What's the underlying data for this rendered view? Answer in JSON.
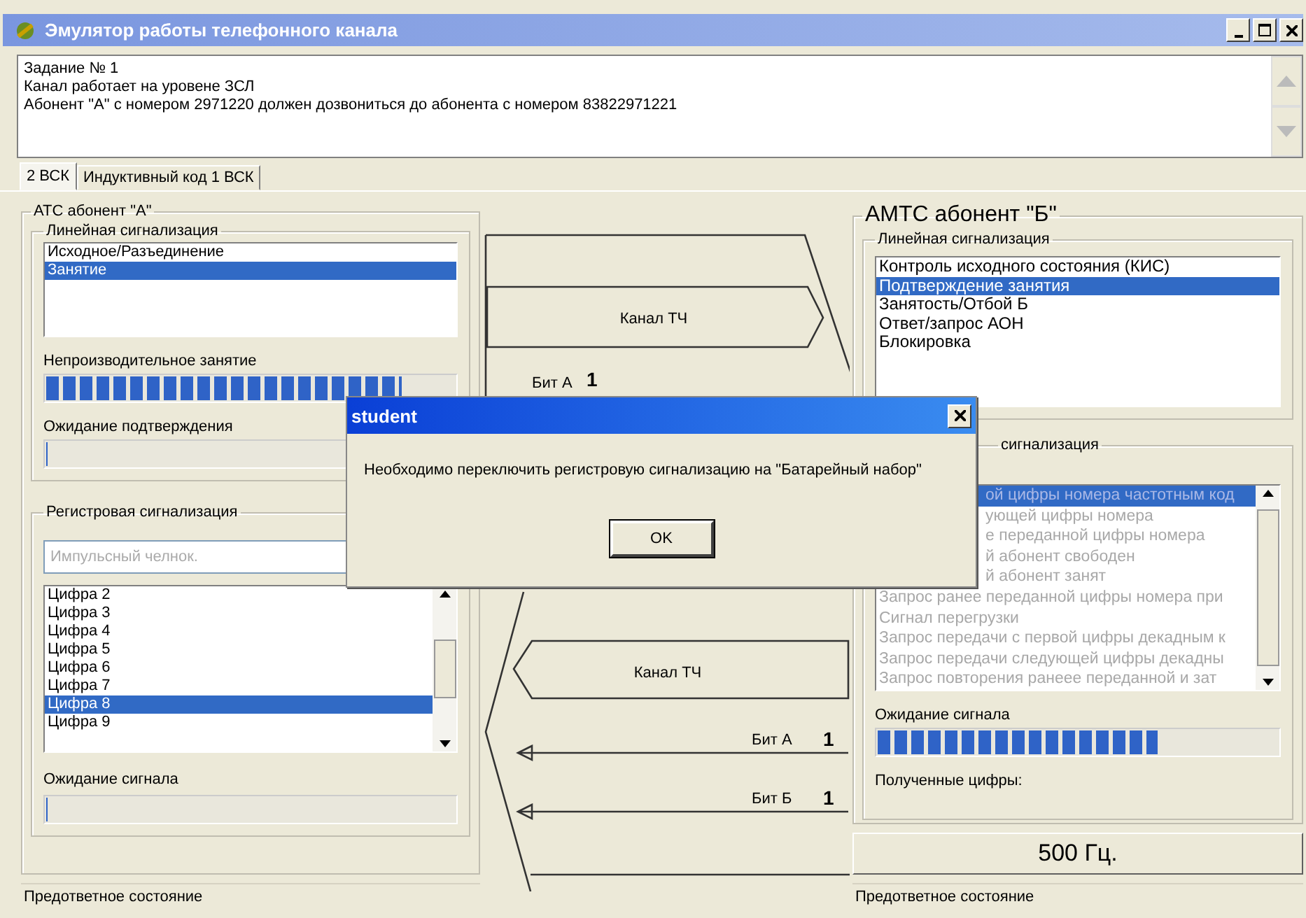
{
  "window": {
    "title": "Эмулятор работы телефонного канала"
  },
  "task_text": [
    "Задание № 1",
    "Канал работает на уровене ЗСЛ",
    "Абонент \"А\" с номером 2971220 должен дозвониться до абонента с номером 83822971221"
  ],
  "tabs": [
    {
      "label": "2 ВСК",
      "selected": true
    },
    {
      "label": "Индуктивный код 1 ВСК",
      "selected": false
    }
  ],
  "station_a": {
    "title": "АТС  абонент \"А\"",
    "line_signaling": {
      "title": "Линейная сигнализация",
      "items": [
        {
          "label": "Исходное/Разъединение",
          "selected": false
        },
        {
          "label": "Занятие",
          "selected": true
        }
      ]
    },
    "meters": [
      {
        "label": "Непроизводительное занятие",
        "level": 0.87
      },
      {
        "label": "Ожидание подтверждения",
        "level": 0
      }
    ],
    "register_signaling": {
      "title": "Регистровая сигнализация",
      "mode_field": {
        "value": "Импульсный челнок.",
        "disabled": true
      },
      "items": [
        {
          "label": "Цифра 2",
          "selected": false
        },
        {
          "label": "Цифра 3",
          "selected": false
        },
        {
          "label": "Цифра 4",
          "selected": false
        },
        {
          "label": "Цифра 5",
          "selected": false
        },
        {
          "label": "Цифра 6",
          "selected": false
        },
        {
          "label": "Цифра 7",
          "selected": false
        },
        {
          "label": "Цифра 8",
          "selected": true
        },
        {
          "label": "Цифра 9",
          "selected": false
        }
      ],
      "meter": {
        "label": "Ожидание сигнала",
        "level": 0
      }
    },
    "status": "Предответное состояние"
  },
  "channel": {
    "forward_label": "Канал ТЧ",
    "forward_bits": [
      {
        "label": "Бит А",
        "value": "1"
      }
    ],
    "backward_label": "Канал ТЧ",
    "backward_bits": [
      {
        "label": "Бит А",
        "value": "1"
      },
      {
        "label": "Бит Б",
        "value": "1"
      }
    ]
  },
  "station_b": {
    "title": "АМТС  абонент \"Б\"",
    "line_signaling": {
      "title": "Линейная сигнализация",
      "items": [
        {
          "label": "Контроль исходного состояния (КИС)",
          "selected": false
        },
        {
          "label": "Подтверждение занятия",
          "selected": true
        },
        {
          "label": "Занятость/Отбой Б",
          "selected": false
        },
        {
          "label": "Ответ/запрос АОН",
          "selected": false
        },
        {
          "label": "Блокировка",
          "selected": false
        }
      ]
    },
    "register_signaling": {
      "title": "сигнализация",
      "disabled": true,
      "items": [
        {
          "label": "ой цифры номера частотным код",
          "selected": true,
          "kind": "clipped"
        },
        {
          "label": "ующей цифры номера",
          "selected": false,
          "kind": "clipped"
        },
        {
          "label": "е переданной цифры номера",
          "selected": false,
          "kind": "clipped"
        },
        {
          "label": "й абонент свободен",
          "selected": false,
          "kind": "clipped"
        },
        {
          "label": "й абонент занят",
          "selected": false,
          "kind": "clipped"
        },
        {
          "label": "Запрос ранее переданной цифры номера при",
          "selected": false,
          "kind": "full"
        },
        {
          "label": "Сигнал перегрузки",
          "selected": false,
          "kind": "full"
        },
        {
          "label": "Запрос передачи с первой цифры декадным к",
          "selected": false,
          "kind": "full"
        },
        {
          "label": "Запрос передачи следующей цифры декадны",
          "selected": false,
          "kind": "full"
        },
        {
          "label": "Запрос повторения ранеее переданной и зат",
          "selected": false,
          "kind": "full"
        }
      ],
      "meter": {
        "label": "Ожидание сигнала",
        "level": 0.7
      },
      "received_label": "Полученные цифры:"
    },
    "tone_button": "500 Гц.",
    "status": "Предответное состояние"
  },
  "dialog": {
    "title": "student",
    "message": "Необходимо переключить регистровую сигнализацию на \"Батарейный набор\"",
    "button": "OK"
  }
}
